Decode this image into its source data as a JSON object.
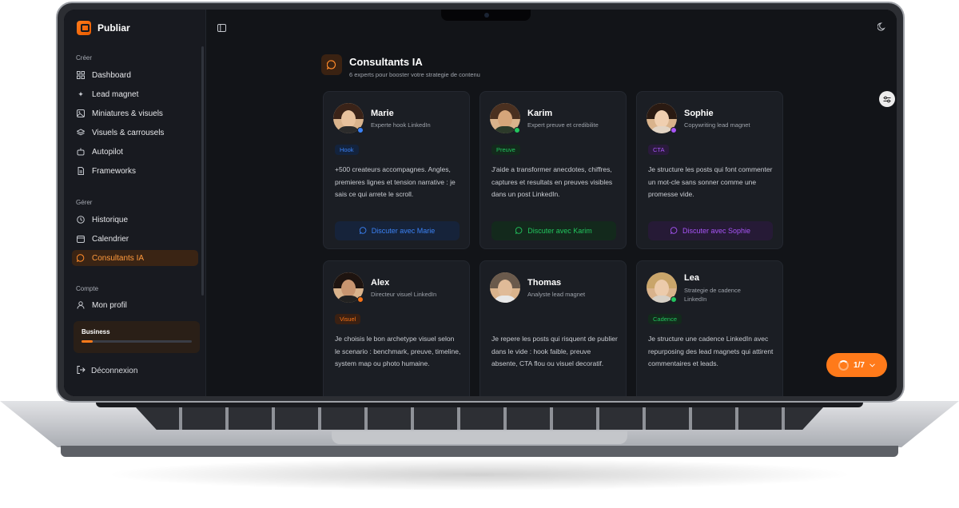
{
  "app": {
    "name": "Publiar"
  },
  "sidebar": {
    "sections": {
      "create": "Créer",
      "manage": "Gérer",
      "account": "Compte"
    },
    "create_items": [
      {
        "label": "Dashboard",
        "icon": "grid-icon"
      },
      {
        "label": "Lead magnet",
        "icon": "magnet-icon"
      },
      {
        "label": "Miniatures & visuels",
        "icon": "image-icon"
      },
      {
        "label": "Visuels & carrousels",
        "icon": "layers-icon"
      },
      {
        "label": "Autopilot",
        "icon": "robot-icon"
      },
      {
        "label": "Frameworks",
        "icon": "document-icon"
      }
    ],
    "manage_items": [
      {
        "label": "Historique",
        "icon": "clock-icon"
      },
      {
        "label": "Calendrier",
        "icon": "calendar-icon"
      },
      {
        "label": "Consultants IA",
        "icon": "chat-icon",
        "active": true
      }
    ],
    "account_items": [
      {
        "label": "Mon profil",
        "icon": "user-icon"
      }
    ],
    "plan": {
      "name": "Business",
      "usage_fraction": 0.1
    },
    "logout_label": "Déconnexion"
  },
  "header": {
    "title": "Consultants IA",
    "subtitle": "6 experts pour booster votre strategie de contenu"
  },
  "consultants": [
    {
      "name": "Marie",
      "role": "Experte hook LinkedIn",
      "tag": "Hook",
      "color": "#3b82f6",
      "description": "+500 createurs accompagnes. Angles, premieres lignes et tension narrative : je sais ce qui arrete le scroll.",
      "cta": "Discuter avec Marie"
    },
    {
      "name": "Karim",
      "role": "Expert preuve et credibilite",
      "tag": "Preuve",
      "color": "#22c55e",
      "description": "J'aide a transformer anecdotes, chiffres, captures et resultats en preuves visibles dans un post LinkedIn.",
      "cta": "Discuter avec Karim"
    },
    {
      "name": "Sophie",
      "role": "Copywriting lead magnet",
      "tag": "CTA",
      "color": "#a855f7",
      "description": "Je structure les posts qui font commenter un mot-cle sans sonner comme une promesse vide.",
      "cta": "Discuter avec Sophie"
    },
    {
      "name": "Alex",
      "role": "Directeur visuel LinkedIn",
      "tag": "Visuel",
      "color": "#f97316",
      "description": "Je choisis le bon archetype visuel selon le scenario : benchmark, preuve, timeline, system map ou photo humaine."
    },
    {
      "name": "Thomas",
      "role": "Analyste lead magnet",
      "tag": "",
      "color": "#9ca3af",
      "description": "Je repere les posts qui risquent de publier dans le vide : hook faible, preuve absente, CTA flou ou visuel decoratif."
    },
    {
      "name": "Lea",
      "role": "Strategie de cadence LinkedIn",
      "tag": "Cadence",
      "color": "#22c55e",
      "description": "Je structure une cadence LinkedIn avec repurposing des lead magnets qui attirent commentaires et leads."
    }
  ],
  "progress_counter": "1/7"
}
